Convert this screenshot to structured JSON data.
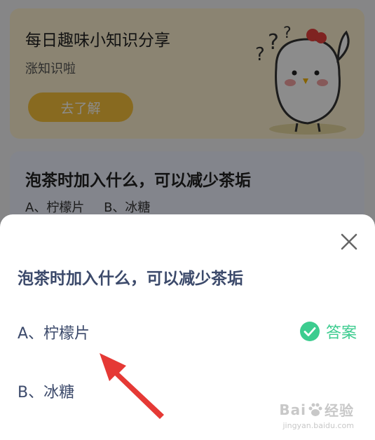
{
  "background": {
    "promo": {
      "title": "每日趣味小知识分享",
      "subtitle": "涨知识啦",
      "button_label": "去了解"
    },
    "question_card": {
      "title": "泡茶时加入什么，可以减少茶垢",
      "option_a": "A、柠檬片",
      "option_b": "B、冰糖"
    }
  },
  "sheet": {
    "title": "泡茶时加入什么，可以减少茶垢",
    "options": [
      {
        "label": "A、柠檬片",
        "is_answer": true
      },
      {
        "label": "B、冰糖",
        "is_answer": false
      }
    ],
    "answer_badge_label": "答案"
  },
  "watermark": {
    "brand_left": "Bai",
    "brand_right": "经验",
    "url": "jingyan.baidu.com"
  },
  "colors": {
    "accent_green": "#3ccc8f",
    "title_navy": "#3c4a6b",
    "arrow_red": "#e53935",
    "promo_yellow": "#f7c23b"
  },
  "icons": [
    "close-icon",
    "check-circle-icon",
    "mascot-chicken",
    "paw-icon",
    "red-arrow"
  ]
}
